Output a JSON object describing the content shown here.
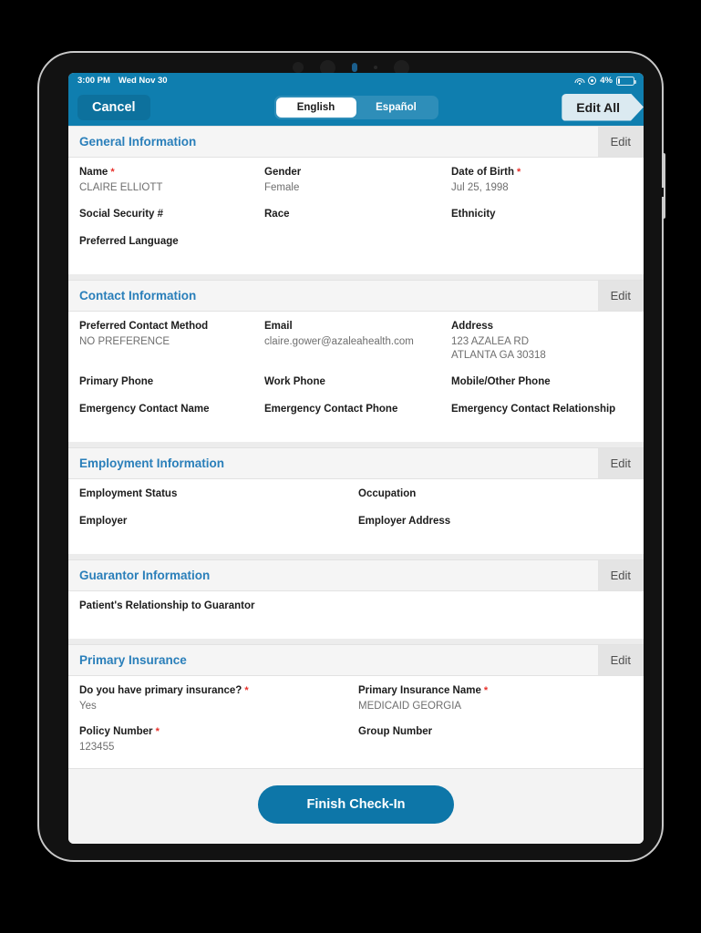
{
  "status_bar": {
    "time": "3:00 PM",
    "date": "Wed Nov 30",
    "battery_percent": "4%",
    "wifi_icon": "wifi-icon",
    "location_icon": "location-icon",
    "battery_icon": "battery-icon"
  },
  "nav": {
    "cancel_label": "Cancel",
    "edit_all_label": "Edit All",
    "languages": [
      {
        "label": "English",
        "selected": true
      },
      {
        "label": "Español",
        "selected": false
      }
    ]
  },
  "colors": {
    "header_blue": "#0f7eaf",
    "section_title_blue": "#2a7fba",
    "primary_button": "#0d76a8",
    "required_red": "#e8302a",
    "value_gray": "#6e6e6e"
  },
  "sections": [
    {
      "title": "General Information",
      "edit_label": "Edit",
      "columns": 3,
      "rows": [
        [
          {
            "label": "Name",
            "required": true,
            "value": "CLAIRE ELLIOTT"
          },
          {
            "label": "Gender",
            "required": false,
            "value": "Female"
          },
          {
            "label": "Date of Birth",
            "required": true,
            "value": "Jul 25, 1998"
          }
        ],
        [
          {
            "label": "Social Security #",
            "required": false,
            "value": ""
          },
          {
            "label": "Race",
            "required": false,
            "value": ""
          },
          {
            "label": "Ethnicity",
            "required": false,
            "value": ""
          }
        ],
        [
          {
            "label": "Preferred Language",
            "required": false,
            "value": ""
          },
          {
            "label": "",
            "required": false,
            "value": ""
          },
          {
            "label": "",
            "required": false,
            "value": ""
          }
        ]
      ]
    },
    {
      "title": "Contact Information",
      "edit_label": "Edit",
      "columns": 3,
      "rows": [
        [
          {
            "label": "Preferred Contact Method",
            "required": false,
            "value": "NO PREFERENCE"
          },
          {
            "label": "Email",
            "required": false,
            "value": "claire.gower@azaleahealth.com"
          },
          {
            "label": "Address",
            "required": false,
            "value": "123 AZALEA RD\nATLANTA GA 30318"
          }
        ],
        [
          {
            "label": "Primary Phone",
            "required": false,
            "value": ""
          },
          {
            "label": "Work Phone",
            "required": false,
            "value": ""
          },
          {
            "label": "Mobile/Other Phone",
            "required": false,
            "value": ""
          }
        ],
        [
          {
            "label": "Emergency Contact Name",
            "required": false,
            "value": ""
          },
          {
            "label": "Emergency Contact Phone",
            "required": false,
            "value": ""
          },
          {
            "label": "Emergency Contact Relationship",
            "required": false,
            "value": ""
          }
        ]
      ]
    },
    {
      "title": "Employment Information",
      "edit_label": "Edit",
      "columns": 2,
      "rows": [
        [
          {
            "label": "Employment Status",
            "required": false,
            "value": ""
          },
          {
            "label": "Occupation",
            "required": false,
            "value": ""
          }
        ],
        [
          {
            "label": "Employer",
            "required": false,
            "value": ""
          },
          {
            "label": "Employer Address",
            "required": false,
            "value": ""
          }
        ]
      ]
    },
    {
      "title": "Guarantor Information",
      "edit_label": "Edit",
      "columns": 2,
      "rows": [
        [
          {
            "label": "Patient's Relationship to Guarantor",
            "required": false,
            "value": ""
          },
          {
            "label": "",
            "required": false,
            "value": ""
          }
        ]
      ]
    },
    {
      "title": "Primary Insurance",
      "edit_label": "Edit",
      "columns": 2,
      "rows": [
        [
          {
            "label": "Do you have primary insurance?",
            "required": true,
            "value": "Yes"
          },
          {
            "label": "Primary Insurance Name",
            "required": true,
            "value": "MEDICAID GEORGIA"
          }
        ],
        [
          {
            "label": "Policy Number",
            "required": true,
            "value": "123455"
          },
          {
            "label": "Group Number",
            "required": false,
            "value": ""
          }
        ]
      ]
    }
  ],
  "footer": {
    "finish_label": "Finish Check-In"
  }
}
